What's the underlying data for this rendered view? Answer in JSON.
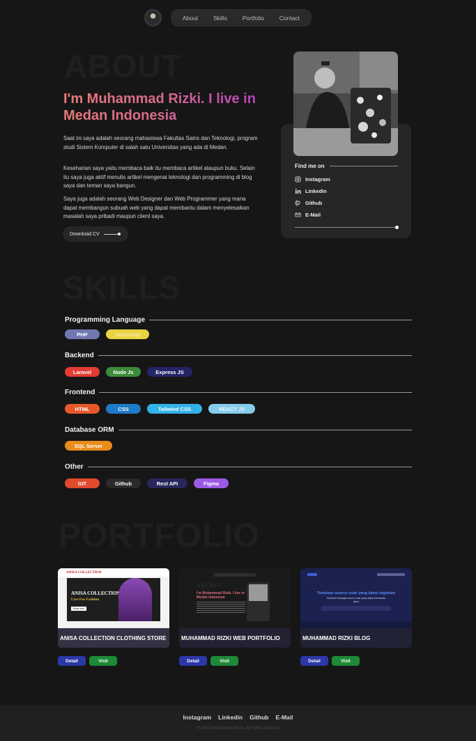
{
  "nav": {
    "items": [
      "About",
      "Skills",
      "Portfolio",
      "Contact"
    ]
  },
  "about": {
    "ghost": "ABOUT",
    "headline": "I'm Muhammad Rizki. I live in Medan Indonesia",
    "paragraphs": [
      "Saat ini saya adalah seorang mahasiswa Fakultas Sains dan Teknologi, program studi Sistem Komputer di salah satu Universitas yang ada di Medan.",
      "Keseharian saya yaitu membaca baik itu membaca artikel ataupun buku. Selain itu saya juga aktif menulis artikel mengenai teknologi dan programming di blog saya dan teman saya bangun.",
      "Saya juga adalah seorang Web Designer dan Web Programmer yang mana dapat membangun subuah web yang dapat membantu dalam menyelesaikan masalah saya pribadi maupun client saya."
    ],
    "download_label": "Download CV",
    "find_me": "Find me on",
    "socials": [
      {
        "label": "Instagram",
        "icon": "instagram-icon"
      },
      {
        "label": "Linkedin",
        "icon": "linkedin-icon"
      },
      {
        "label": "Github",
        "icon": "github-icon"
      },
      {
        "label": "E-Mail",
        "icon": "mail-icon"
      }
    ]
  },
  "skills": {
    "ghost": "SKILLS",
    "categories": [
      {
        "name": "Programming Language",
        "items": [
          {
            "label": "PHP",
            "color": "#7177b0",
            "text": "#ffffff"
          },
          {
            "label": "JavaScript",
            "color": "#e9d33f",
            "text": "#f4e9a6"
          }
        ]
      },
      {
        "name": "Backend",
        "items": [
          {
            "label": "Laravel",
            "color": "#e23c33",
            "text": "#ffffff"
          },
          {
            "label": "Node Js",
            "color": "#3d8a3a",
            "text": "#ffffff"
          },
          {
            "label": "Express JS",
            "color": "#242468",
            "text": "#ffffff"
          }
        ]
      },
      {
        "name": "Frontend",
        "items": [
          {
            "label": "HTML",
            "color": "#e6582a",
            "text": "#ffffff"
          },
          {
            "label": "CSS",
            "color": "#1f7ac8",
            "text": "#ffffff"
          },
          {
            "label": "Tailwind CSS",
            "color": "#33b2e8",
            "text": "#ffffff"
          },
          {
            "label": "REACT JS",
            "color": "#86ccea",
            "text": "#e9f6fb"
          }
        ]
      },
      {
        "name": "Database ORM",
        "items": [
          {
            "label": "SQL Server",
            "color": "#e88c1a",
            "text": "#ffffff"
          }
        ]
      },
      {
        "name": "Other",
        "items": [
          {
            "label": "GIT",
            "color": "#e24a2e",
            "text": "#ffffff"
          },
          {
            "label": "Github",
            "color": "#2a2a2a",
            "text": "#ffffff"
          },
          {
            "label": "Rest API",
            "color": "#27275c",
            "text": "#ffffff"
          },
          {
            "label": "Figma",
            "color": "#9b5ae6",
            "text": "#ffffff"
          }
        ]
      }
    ]
  },
  "portfolio": {
    "ghost": "PORTFOLIO",
    "projects": [
      {
        "title": "ANISA COLLECTION CLOTHING STORE",
        "detail": "Detail",
        "visit": "Visit",
        "thumb": {
          "brand": "ANISA COLLECTION",
          "hero": "ANISA COLLECTION",
          "tag": "Live For Fashion",
          "cta": "Shop now"
        }
      },
      {
        "title": "MUHAMMAD RIZKI WEB PORTFOLIO",
        "detail": "Detail",
        "visit": "Visit",
        "thumb": {
          "ghost": "ABOUT",
          "hero": "I'm Muhammad Rizki. I live in Medan Indonesia"
        }
      },
      {
        "title": "MUHAMMAD RIZKI BLOG",
        "detail": "Detail",
        "visit": "Visit",
        "thumb": {
          "hero": "Temukan source code yang kamu inginkan",
          "sub": "Temukan berbagai source code yang dapat membantu kamu"
        }
      }
    ]
  },
  "footer": {
    "links": [
      "Instagram",
      "Linkedin",
      "Github",
      "E-Mail"
    ],
    "copyright": "© 2023 Muhammad Rizki. All rights reserved"
  }
}
